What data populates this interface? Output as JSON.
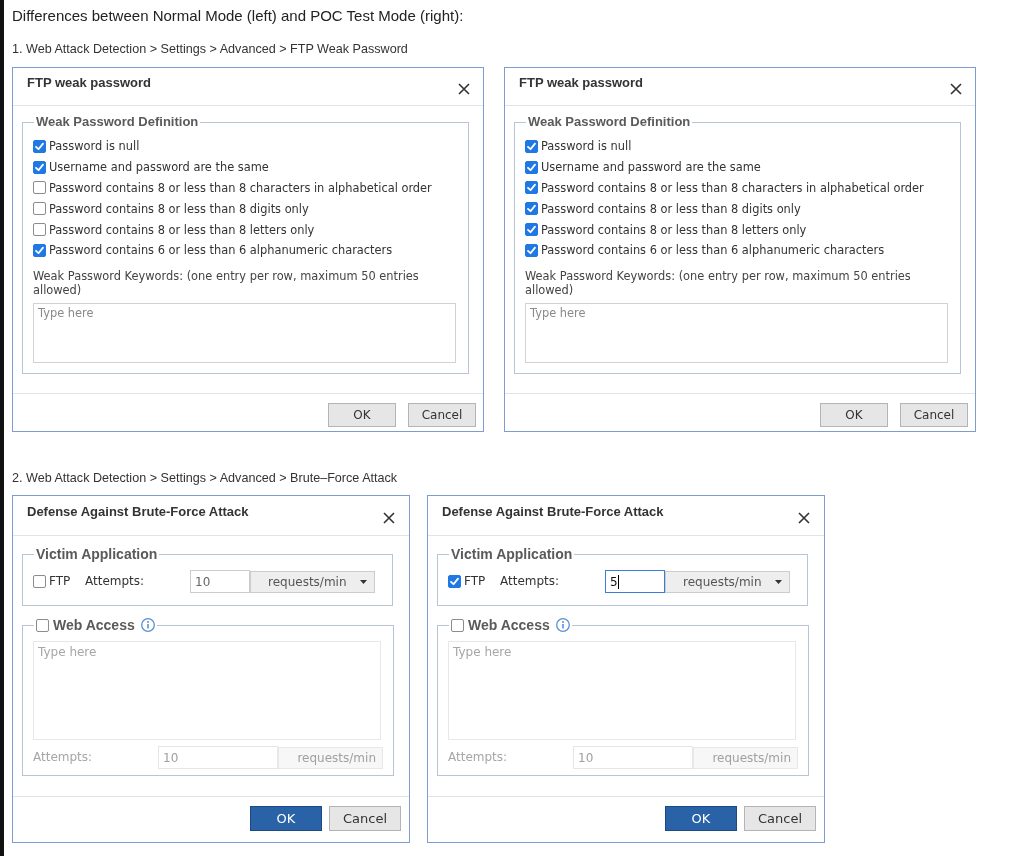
{
  "heading": "Differences between Normal Mode (left) and POC Test Mode (right):",
  "sections": [
    {
      "caption": "1. Web Attack Detection > Settings > Advanced > FTP Weak Password",
      "dialogs": [
        {
          "kind": "weak_password",
          "title": "FTP weak password",
          "legend": "Weak Password Definition",
          "options": [
            {
              "label": "Password is null",
              "checked": true
            },
            {
              "label": "Username and password are the same",
              "checked": true
            },
            {
              "label": "Password contains 8 or less than 8 characters in alphabetical order",
              "checked": false
            },
            {
              "label": "Password contains 8 or less than 8 digits only",
              "checked": false
            },
            {
              "label": "Password contains 8 or less than 8 letters only",
              "checked": false
            },
            {
              "label": "Password contains 6 or less than 6 alphanumeric characters",
              "checked": true
            }
          ],
          "keywords_label": "Weak Password Keywords: (one entry per row, maximum 50 entries allowed)",
          "keywords_field": {
            "placeholder": "Type here"
          },
          "buttons": [
            {
              "label": "OK",
              "primary": false
            },
            {
              "label": "Cancel",
              "primary": false
            }
          ]
        },
        {
          "kind": "weak_password",
          "title": "FTP weak password",
          "legend": "Weak Password Definition",
          "options": [
            {
              "label": "Password is null",
              "checked": true
            },
            {
              "label": "Username and password are the same",
              "checked": true
            },
            {
              "label": "Password contains 8 or less than 8 characters in alphabetical order",
              "checked": true
            },
            {
              "label": "Password contains 8 or less than 8 digits only",
              "checked": true
            },
            {
              "label": "Password contains 8 or less than 8 letters only",
              "checked": true
            },
            {
              "label": "Password contains 6 or less than 6 alphanumeric characters",
              "checked": true
            }
          ],
          "keywords_label": "Weak Password Keywords: (one entry per row, maximum 50 entries allowed)",
          "keywords_field": {
            "placeholder": "Type here"
          },
          "buttons": [
            {
              "label": "OK",
              "primary": false
            },
            {
              "label": "Cancel",
              "primary": false
            }
          ]
        }
      ]
    },
    {
      "caption": "2. Web Attack Detection > Settings > Advanced > Brute–Force Attack",
      "dialogs": [
        {
          "kind": "brute_force",
          "title": "Defense Against Brute-Force Attack",
          "victim_application": {
            "legend": "Victim Application",
            "ftp_checkbox": {
              "label": "FTP",
              "checked": false
            },
            "attempts_label": "Attempts:",
            "attempts_field": {
              "value": "10",
              "focused": false
            },
            "unit_select": {
              "value": "requests/min"
            }
          },
          "web_access": {
            "label": "Web Access",
            "checked": false,
            "text_field": {
              "placeholder": "Type here"
            },
            "attempts_label": "Attempts:",
            "attempts_field": {
              "value": "10"
            },
            "unit": "requests/min"
          },
          "buttons": [
            {
              "label": "OK",
              "primary": true
            },
            {
              "label": "Cancel",
              "primary": false
            }
          ]
        },
        {
          "kind": "brute_force",
          "title": "Defense Against Brute-Force Attack",
          "victim_application": {
            "legend": "Victim Application",
            "ftp_checkbox": {
              "label": "FTP",
              "checked": true
            },
            "attempts_label": "Attempts:",
            "attempts_field": {
              "value": "5",
              "focused": true
            },
            "unit_select": {
              "value": "requests/min"
            }
          },
          "web_access": {
            "label": "Web Access",
            "checked": false,
            "text_field": {
              "placeholder": "Type here"
            },
            "attempts_label": "Attempts:",
            "attempts_field": {
              "value": "10"
            },
            "unit": "requests/min"
          },
          "buttons": [
            {
              "label": "OK",
              "primary": true
            },
            {
              "label": "Cancel",
              "primary": false
            }
          ]
        }
      ]
    }
  ]
}
